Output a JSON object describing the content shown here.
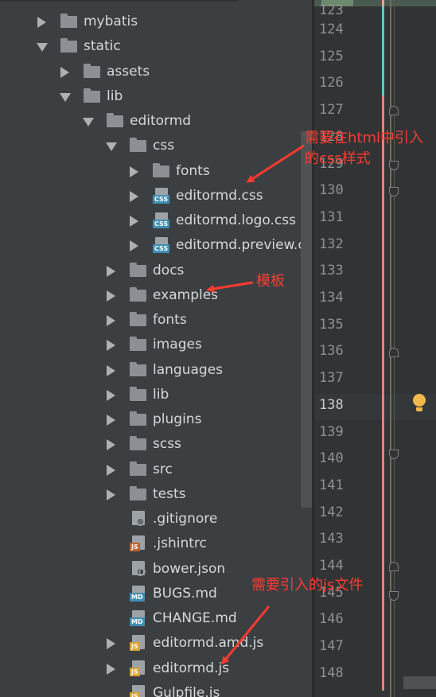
{
  "tree": [
    {
      "label": "mybatis",
      "type": "folder",
      "state": "collapsed",
      "depth": 1
    },
    {
      "label": "static",
      "type": "folder",
      "state": "expanded",
      "depth": 1
    },
    {
      "label": "assets",
      "type": "folder",
      "state": "collapsed",
      "depth": 2
    },
    {
      "label": "lib",
      "type": "folder",
      "state": "expanded",
      "depth": 2
    },
    {
      "label": "editormd",
      "type": "folder",
      "state": "expanded",
      "depth": 3
    },
    {
      "label": "css",
      "type": "folder",
      "state": "expanded",
      "depth": 4
    },
    {
      "label": "fonts",
      "type": "folder",
      "state": "collapsed",
      "depth": 5
    },
    {
      "label": "editormd.css",
      "type": "css",
      "state": "collapsed",
      "depth": 5
    },
    {
      "label": "editormd.logo.css",
      "type": "css",
      "state": "collapsed",
      "depth": 5
    },
    {
      "label": "editormd.preview.css",
      "type": "css",
      "state": "collapsed",
      "depth": 5
    },
    {
      "label": "docs",
      "type": "folder",
      "state": "collapsed",
      "depth": 4
    },
    {
      "label": "examples",
      "type": "folder",
      "state": "collapsed",
      "depth": 4
    },
    {
      "label": "fonts",
      "type": "folder",
      "state": "collapsed",
      "depth": 4
    },
    {
      "label": "images",
      "type": "folder",
      "state": "collapsed",
      "depth": 4
    },
    {
      "label": "languages",
      "type": "folder",
      "state": "collapsed",
      "depth": 4
    },
    {
      "label": "lib",
      "type": "folder",
      "state": "collapsed",
      "depth": 4
    },
    {
      "label": "plugins",
      "type": "folder",
      "state": "collapsed",
      "depth": 4
    },
    {
      "label": "scss",
      "type": "folder",
      "state": "collapsed",
      "depth": 4
    },
    {
      "label": "src",
      "type": "folder",
      "state": "collapsed",
      "depth": 4
    },
    {
      "label": "tests",
      "type": "folder",
      "state": "collapsed",
      "depth": 4
    },
    {
      "label": ".gitignore",
      "type": "ignore",
      "state": "none",
      "depth": 4
    },
    {
      "label": ".jshintrc",
      "type": "jshint",
      "state": "none",
      "depth": 4
    },
    {
      "label": "bower.json",
      "type": "json",
      "state": "none",
      "depth": 4
    },
    {
      "label": "BUGS.md",
      "type": "md",
      "state": "none",
      "depth": 4
    },
    {
      "label": "CHANGE.md",
      "type": "md",
      "state": "none",
      "depth": 4
    },
    {
      "label": "editormd.amd.js",
      "type": "js",
      "state": "collapsed",
      "depth": 4
    },
    {
      "label": "editormd.js",
      "type": "js",
      "state": "collapsed",
      "depth": 4
    },
    {
      "label": "Gulpfile.js",
      "type": "js",
      "state": "none",
      "depth": 4
    }
  ],
  "gutter": {
    "lines": [
      "124",
      "125",
      "126",
      "127",
      "128",
      "129",
      "130",
      "131",
      "132",
      "133",
      "134",
      "135",
      "136",
      "137",
      "138",
      "139",
      "140",
      "141",
      "142",
      "143",
      "144",
      "145",
      "146",
      "147",
      "148"
    ],
    "current_line": "138",
    "top_partial": "123"
  },
  "annotations": {
    "css_note": "需要在html中引入的css样式",
    "template_note": "模板",
    "js_note": "需要引入的js文件"
  },
  "colors": {
    "annotation": "#ff3b30",
    "css_badge": "#3f8fb5",
    "js_badge": "#d9a32e",
    "md_badge": "#3f8fb5",
    "jshint_badge": "#c0622f"
  },
  "icons": {
    "folder": "folder-icon",
    "css": "css-file-icon",
    "js": "js-file-icon",
    "md": "markdown-file-icon",
    "json": "json-file-icon",
    "ignore": "gitignore-file-icon",
    "jshint": "jshint-file-icon",
    "bulb": "lightbulb-icon"
  }
}
